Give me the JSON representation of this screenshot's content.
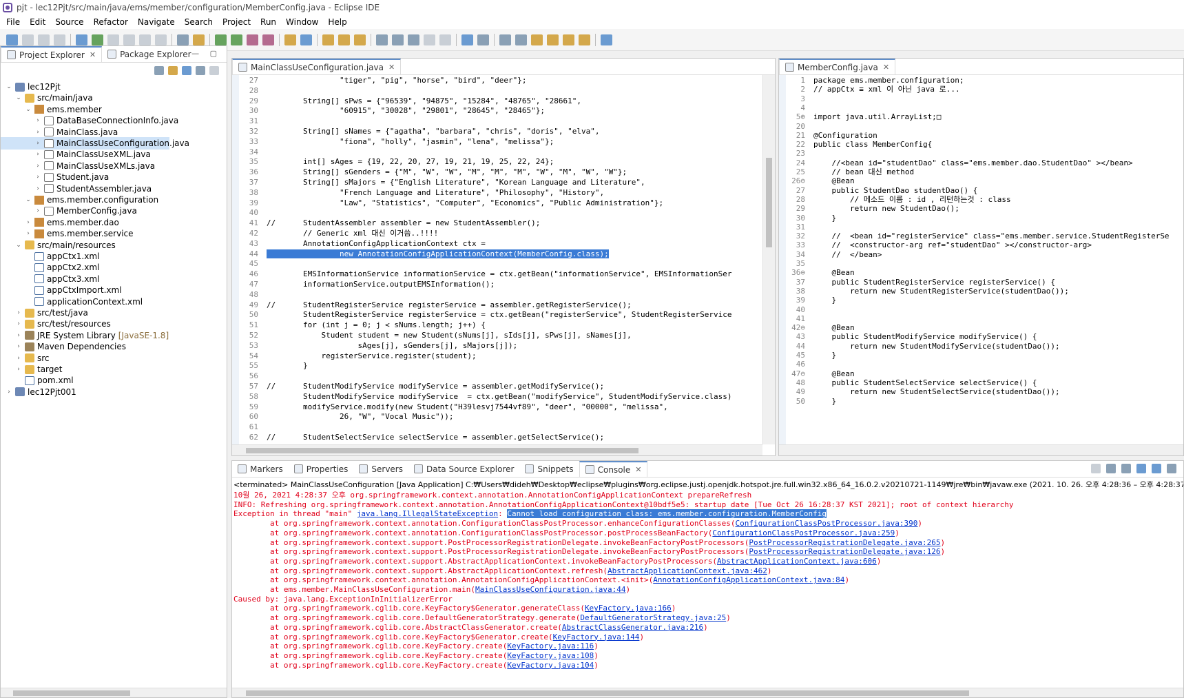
{
  "window": {
    "title": "pjt - lec12Pjt/src/main/java/ems/member/configuration/MemberConfig.java - Eclipse IDE"
  },
  "menu": [
    "File",
    "Edit",
    "Source",
    "Refactor",
    "Navigate",
    "Search",
    "Project",
    "Run",
    "Window",
    "Help"
  ],
  "explorer": {
    "tabs": [
      {
        "label": "Project Explorer",
        "close": "✕"
      },
      {
        "label": "Package Explorer"
      }
    ],
    "tree": [
      {
        "label": "lec12Pjt",
        "twisty": "⌄",
        "icon": "project",
        "depth": 0
      },
      {
        "label": "src/main/java",
        "twisty": "⌄",
        "icon": "folder",
        "depth": 1
      },
      {
        "label": "ems.member",
        "twisty": "⌄",
        "icon": "pkg",
        "depth": 2
      },
      {
        "label": "DataBaseConnectionInfo.java",
        "twisty": "›",
        "icon": "java",
        "depth": 3
      },
      {
        "label": "MainClass.java",
        "twisty": "›",
        "icon": "java",
        "depth": 3
      },
      {
        "label": "MainClassUseConfiguration.java",
        "twisty": "›",
        "icon": "java",
        "depth": 3,
        "selected": true
      },
      {
        "label": "MainClassUseXML.java",
        "twisty": "›",
        "icon": "java",
        "depth": 3
      },
      {
        "label": "MainClassUseXMLs.java",
        "twisty": "›",
        "icon": "java",
        "depth": 3
      },
      {
        "label": "Student.java",
        "twisty": "›",
        "icon": "java",
        "depth": 3
      },
      {
        "label": "StudentAssembler.java",
        "twisty": "›",
        "icon": "java",
        "depth": 3
      },
      {
        "label": "ems.member.configuration",
        "twisty": "⌄",
        "icon": "pkg",
        "depth": 2
      },
      {
        "label": "MemberConfig.java",
        "twisty": "›",
        "icon": "java",
        "depth": 3
      },
      {
        "label": "ems.member.dao",
        "twisty": "›",
        "icon": "pkg",
        "depth": 2
      },
      {
        "label": "ems.member.service",
        "twisty": "›",
        "icon": "pkg",
        "depth": 2
      },
      {
        "label": "src/main/resources",
        "twisty": "⌄",
        "icon": "folder",
        "depth": 1
      },
      {
        "label": "appCtx1.xml",
        "twisty": "",
        "icon": "xml",
        "depth": 2
      },
      {
        "label": "appCtx2.xml",
        "twisty": "",
        "icon": "xml",
        "depth": 2
      },
      {
        "label": "appCtx3.xml",
        "twisty": "",
        "icon": "xml",
        "depth": 2
      },
      {
        "label": "appCtxImport.xml",
        "twisty": "",
        "icon": "xml",
        "depth": 2
      },
      {
        "label": "applicationContext.xml",
        "twisty": "",
        "icon": "xml",
        "depth": 2
      },
      {
        "label": "src/test/java",
        "twisty": "›",
        "icon": "folder",
        "depth": 1
      },
      {
        "label": "src/test/resources",
        "twisty": "›",
        "icon": "folder",
        "depth": 1
      },
      {
        "label": "JRE System Library",
        "twisty": "›",
        "icon": "lib",
        "depth": 1,
        "suffix": "[JavaSE-1.8]"
      },
      {
        "label": "Maven Dependencies",
        "twisty": "›",
        "icon": "lib",
        "depth": 1
      },
      {
        "label": "src",
        "twisty": "›",
        "icon": "folder",
        "depth": 1
      },
      {
        "label": "target",
        "twisty": "›",
        "icon": "folder",
        "depth": 1
      },
      {
        "label": "pom.xml",
        "twisty": "",
        "icon": "xml",
        "depth": 1
      },
      {
        "label": "lec12Pjt001",
        "twisty": "›",
        "icon": "project",
        "depth": 0
      }
    ]
  },
  "editor_main": {
    "tab": "MainClassUseConfiguration.java",
    "close": "✕",
    "lines": [
      {
        "n": "27",
        "t": "                \"tiger\", \"pig\", \"horse\", \"bird\", \"deer\"};"
      },
      {
        "n": "28",
        "t": ""
      },
      {
        "n": "29",
        "t": "        String[] sPws = {\"96539\", \"94875\", \"15284\", \"48765\", \"28661\","
      },
      {
        "n": "30",
        "t": "                \"60915\", \"30028\", \"29801\", \"28645\", \"28465\"};"
      },
      {
        "n": "31",
        "t": ""
      },
      {
        "n": "32",
        "t": "        String[] sNames = {\"agatha\", \"barbara\", \"chris\", \"doris\", \"elva\","
      },
      {
        "n": "33",
        "t": "                \"fiona\", \"holly\", \"jasmin\", \"lena\", \"melissa\"};"
      },
      {
        "n": "34",
        "t": ""
      },
      {
        "n": "35",
        "t": "        int[] sAges = {19, 22, 20, 27, 19, 21, 19, 25, 22, 24};"
      },
      {
        "n": "36",
        "t": "        String[] sGenders = {\"M\", \"W\", \"W\", \"M\", \"M\", \"M\", \"W\", \"M\", \"W\", \"W\"};"
      },
      {
        "n": "37",
        "t": "        String[] sMajors = {\"English Literature\", \"Korean Language and Literature\","
      },
      {
        "n": "38",
        "t": "                \"French Language and Literature\", \"Philosophy\", \"History\","
      },
      {
        "n": "39",
        "t": "                \"Law\", \"Statistics\", \"Computer\", \"Economics\", \"Public Administration\"};"
      },
      {
        "n": "40",
        "t": ""
      },
      {
        "n": "41",
        "t": "//      StudentAssembler assembler = new StudentAssembler();"
      },
      {
        "n": "42",
        "t": "        // Generic xml 대신 이거씀..!!!!"
      },
      {
        "n": "43",
        "t": "        AnnotationConfigApplicationContext ctx ="
      },
      {
        "n": "44",
        "t": "                new AnnotationConfigApplicationContext(MemberConfig.class);",
        "sel": true
      },
      {
        "n": "45",
        "t": ""
      },
      {
        "n": "46",
        "t": "        EMSInformationService informationService = ctx.getBean(\"informationService\", EMSInformationSer"
      },
      {
        "n": "47",
        "t": "        informationService.outputEMSInformation();"
      },
      {
        "n": "48",
        "t": ""
      },
      {
        "n": "49",
        "t": "//      StudentRegisterService registerService = assembler.getRegisterService();"
      },
      {
        "n": "50",
        "t": "        StudentRegisterService registerService = ctx.getBean(\"registerService\", StudentRegisterService"
      },
      {
        "n": "51",
        "t": "        for (int j = 0; j < sNums.length; j++) {"
      },
      {
        "n": "52",
        "t": "            Student student = new Student(sNums[j], sIds[j], sPws[j], sNames[j],"
      },
      {
        "n": "53",
        "t": "                    sAges[j], sGenders[j], sMajors[j]);"
      },
      {
        "n": "54",
        "t": "            registerService.register(student);"
      },
      {
        "n": "55",
        "t": "        }"
      },
      {
        "n": "56",
        "t": ""
      },
      {
        "n": "57",
        "t": "//      StudentModifyService modifyService = assembler.getModifyService();"
      },
      {
        "n": "58",
        "t": "        StudentModifyService modifyService  = ctx.getBean(\"modifyService\", StudentModifyService.class)"
      },
      {
        "n": "59",
        "t": "        modifyService.modify(new Student(\"H39lesvj7544vf89\", \"deer\", \"00000\", \"melissa\","
      },
      {
        "n": "60",
        "t": "                26, \"W\", \"Vocal Music\"));"
      },
      {
        "n": "61",
        "t": ""
      },
      {
        "n": "62",
        "t": "//      StudentSelectService selectService = assembler.getSelectService();"
      }
    ]
  },
  "editor_config": {
    "tab": "MemberConfig.java",
    "close": "✕",
    "lines": [
      {
        "n": "1",
        "t": "package ems.member.configuration;"
      },
      {
        "n": "2",
        "t": "// appCtx ≡ xml 이 아닌 java 로..."
      },
      {
        "n": "3",
        "t": ""
      },
      {
        "n": "4",
        "t": ""
      },
      {
        "n": "5⊕",
        "t": "import java.util.ArrayList;□"
      },
      {
        "n": "20",
        "t": ""
      },
      {
        "n": "21",
        "t": "@Configuration"
      },
      {
        "n": "22",
        "t": "public class MemberConfig{"
      },
      {
        "n": "23",
        "t": ""
      },
      {
        "n": "24",
        "t": "    //<bean id=\"studentDao\" class=\"ems.member.dao.StudentDao\" ></bean>"
      },
      {
        "n": "25",
        "t": "    // bean 대신 method"
      },
      {
        "n": "26⊖",
        "t": "    @Bean"
      },
      {
        "n": "27",
        "t": "    public StudentDao studentDao() {"
      },
      {
        "n": "28",
        "t": "        // 메소드 이름 : id , 리턴하는것 : class"
      },
      {
        "n": "29",
        "t": "        return new StudentDao();"
      },
      {
        "n": "30",
        "t": "    }"
      },
      {
        "n": "31",
        "t": ""
      },
      {
        "n": "32",
        "t": "    //  <bean id=\"registerService\" class=\"ems.member.service.StudentRegisterSe"
      },
      {
        "n": "33",
        "t": "    //  <constructor-arg ref=\"studentDao\" ></constructor-arg>"
      },
      {
        "n": "34",
        "t": "    //  </bean>"
      },
      {
        "n": "35",
        "t": ""
      },
      {
        "n": "36⊖",
        "t": "    @Bean"
      },
      {
        "n": "37",
        "t": "    public StudentRegisterService registerService() {"
      },
      {
        "n": "38",
        "t": "        return new StudentRegisterService(studentDao());"
      },
      {
        "n": "39",
        "t": "    }"
      },
      {
        "n": "40",
        "t": ""
      },
      {
        "n": "41",
        "t": ""
      },
      {
        "n": "42⊖",
        "t": "    @Bean"
      },
      {
        "n": "43",
        "t": "    public StudentModifyService modifyService() {"
      },
      {
        "n": "44",
        "t": "        return new StudentModifyService(studentDao());"
      },
      {
        "n": "45",
        "t": "    }"
      },
      {
        "n": "46",
        "t": ""
      },
      {
        "n": "47⊖",
        "t": "    @Bean"
      },
      {
        "n": "48",
        "t": "    public StudentSelectService selectService() {"
      },
      {
        "n": "49",
        "t": "        return new StudentSelectService(studentDao());"
      },
      {
        "n": "50",
        "t": "    }"
      }
    ]
  },
  "console": {
    "tabs": [
      {
        "label": "Markers"
      },
      {
        "label": "Properties"
      },
      {
        "label": "Servers"
      },
      {
        "label": "Data Source Explorer"
      },
      {
        "label": "Snippets"
      },
      {
        "label": "Console",
        "active": true,
        "close": "✕"
      }
    ],
    "status": "<terminated> MainClassUseConfiguration [Java Application] C:₩Users₩dideh₩Desktop₩eclipse₩plugins₩org.eclipse.justj.openjdk.hotspot.jre.full.win32.x86_64_16.0.2.v20210721-1149₩jre₩bin₩javaw.exe  (2021. 10. 26. 오후 4:28:36 – 오후 4:28:37)",
    "lines": [
      {
        "pre": "10월 26, 2021 4:28:37 오후 org.springframework.context.annotation.AnnotationConfigApplicationContext prepareRefresh"
      },
      {
        "pre": "INFO: Refreshing org.springframework.context.annotation.AnnotationConfigApplicationContext@10bdf5e5: startup date [Tue Oct 26 16:28:37 KST 2021]; root of context hierarchy"
      },
      {
        "pre": "Exception in thread \"main\" ",
        "link": "java.lang.IllegalStateException",
        "mid": ": ",
        "hl": "Cannot load configuration class: ems.member.configuration.MemberConfig"
      },
      {
        "pre": "        at org.springframework.context.annotation.ConfigurationClassPostProcessor.enhanceConfigurationClasses(",
        "link": "ConfigurationClassPostProcessor.java:390",
        "post": ")"
      },
      {
        "pre": "        at org.springframework.context.annotation.ConfigurationClassPostProcessor.postProcessBeanFactory(",
        "link": "ConfigurationClassPostProcessor.java:259",
        "post": ")"
      },
      {
        "pre": "        at org.springframework.context.support.PostProcessorRegistrationDelegate.invokeBeanFactoryPostProcessors(",
        "link": "PostProcessorRegistrationDelegate.java:265",
        "post": ")"
      },
      {
        "pre": "        at org.springframework.context.support.PostProcessorRegistrationDelegate.invokeBeanFactoryPostProcessors(",
        "link": "PostProcessorRegistrationDelegate.java:126",
        "post": ")"
      },
      {
        "pre": "        at org.springframework.context.support.AbstractApplicationContext.invokeBeanFactoryPostProcessors(",
        "link": "AbstractApplicationContext.java:606",
        "post": ")"
      },
      {
        "pre": "        at org.springframework.context.support.AbstractApplicationContext.refresh(",
        "link": "AbstractApplicationContext.java:462",
        "post": ")"
      },
      {
        "pre": "        at org.springframework.context.annotation.AnnotationConfigApplicationContext.<init>(",
        "link": "AnnotationConfigApplicationContext.java:84",
        "post": ")"
      },
      {
        "pre": "        at ems.member.MainClassUseConfiguration.main(",
        "link": "MainClassUseConfiguration.java:44",
        "post": ")"
      },
      {
        "pre": "Caused by: java.lang.ExceptionInInitializerError"
      },
      {
        "pre": "        at org.springframework.cglib.core.KeyFactory$Generator.generateClass(",
        "link": "KeyFactory.java:166",
        "post": ")"
      },
      {
        "pre": "        at org.springframework.cglib.core.DefaultGeneratorStrategy.generate(",
        "link": "DefaultGeneratorStrategy.java:25",
        "post": ")"
      },
      {
        "pre": "        at org.springframework.cglib.core.AbstractClassGenerator.create(",
        "link": "AbstractClassGenerator.java:216",
        "post": ")"
      },
      {
        "pre": "        at org.springframework.cglib.core.KeyFactory$Generator.create(",
        "link": "KeyFactory.java:144",
        "post": ")"
      },
      {
        "pre": "        at org.springframework.cglib.core.KeyFactory.create(",
        "link": "KeyFactory.java:116",
        "post": ")"
      },
      {
        "pre": "        at org.springframework.cglib.core.KeyFactory.create(",
        "link": "KeyFactory.java:108",
        "post": ")"
      },
      {
        "pre": "        at org.springframework.cglib.core.KeyFactory.create(",
        "link": "KeyFactory.java:104",
        "post": ")"
      }
    ]
  }
}
